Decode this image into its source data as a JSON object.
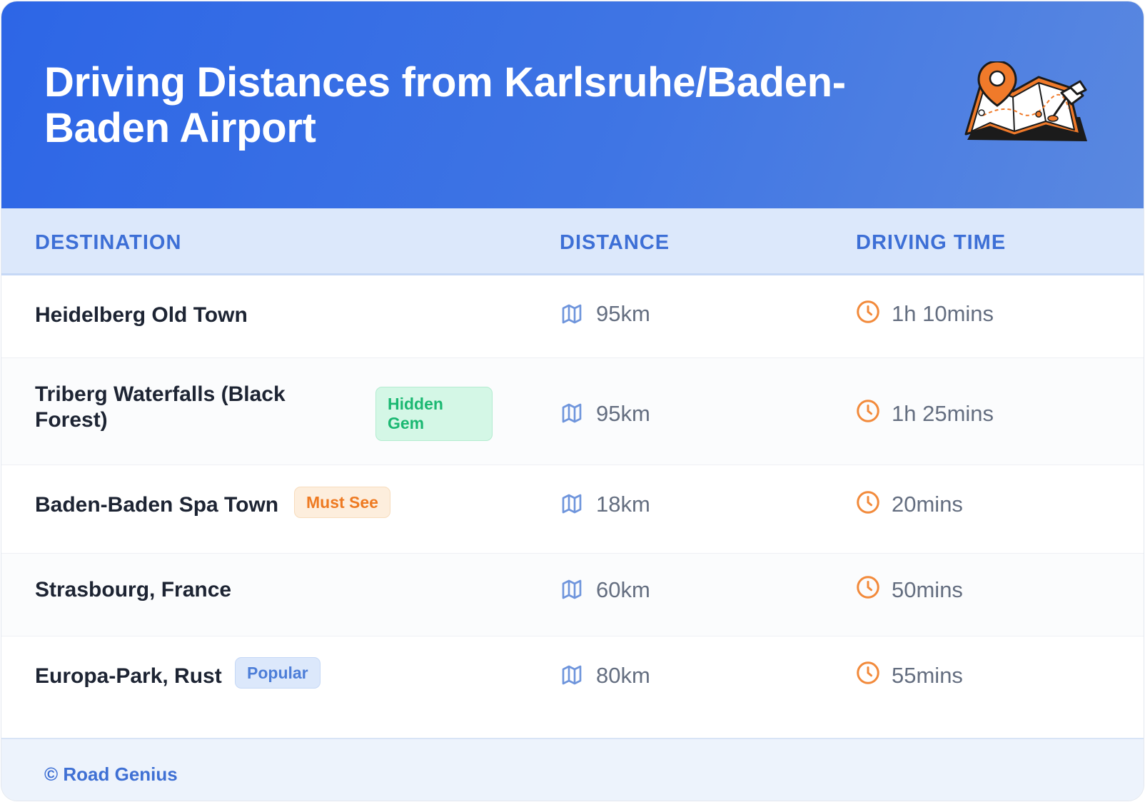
{
  "title": "Driving Distances from Karlsruhe/Baden-Baden Airport",
  "illustration_icon": "map-with-location-pin-icon",
  "colors": {
    "header_gradient_start": "#2d66e6",
    "header_gradient_end": "#5a88e0",
    "column_header_text": "#3d6fd6",
    "map_icon": "#6f95dc",
    "clock_icon": "#f28a3b"
  },
  "columns": [
    "DESTINATION",
    "DISTANCE",
    "DRIVING TIME"
  ],
  "rows": [
    {
      "destination": "Heidelberg Old Town",
      "badge": "",
      "distance": "95km",
      "time": "1h 10mins"
    },
    {
      "destination": "Triberg Waterfalls (Black Forest)",
      "badge": "Hidden Gem",
      "distance": "95km",
      "time": "1h 25mins"
    },
    {
      "destination": "Baden-Baden Spa Town",
      "badge": "Must See",
      "distance": "18km",
      "time": "20mins"
    },
    {
      "destination": "Strasbourg, France",
      "badge": "",
      "distance": "60km",
      "time": "50mins"
    },
    {
      "destination": "Europa-Park, Rust",
      "badge": "Popular",
      "distance": "80km",
      "time": "55mins"
    }
  ],
  "footer": "© Road Genius"
}
